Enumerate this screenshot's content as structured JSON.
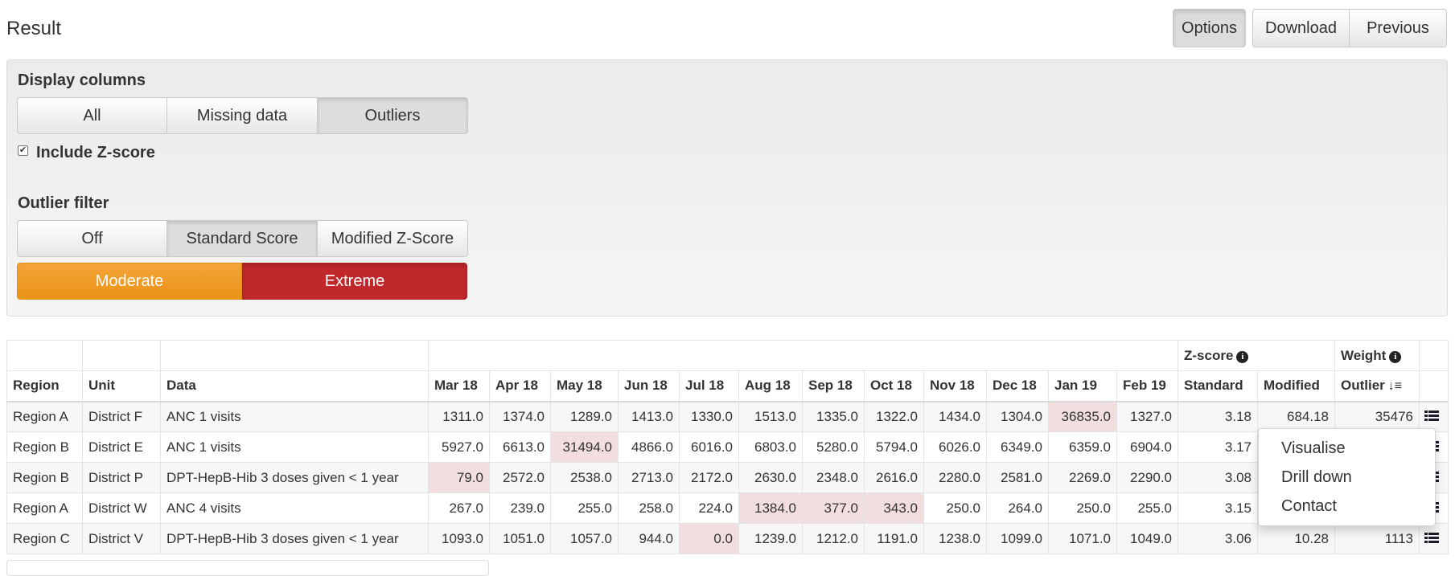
{
  "page": {
    "title": "Result"
  },
  "toolbar": {
    "options_label": "Options",
    "download_label": "Download",
    "previous_label": "Previous"
  },
  "options": {
    "display_columns": {
      "label": "Display columns",
      "buttons": [
        "All",
        "Missing data",
        "Outliers"
      ],
      "active": "Outliers"
    },
    "include_zscore": {
      "label": "Include Z-score",
      "checked": true
    },
    "outlier_filter": {
      "label": "Outlier filter",
      "buttons": [
        "Off",
        "Standard Score",
        "Modified Z-Score"
      ],
      "active": "Standard Score"
    },
    "severity": {
      "moderate": "Moderate",
      "extreme": "Extreme",
      "active": "Extreme",
      "colors": {
        "moderate": "#eb9316",
        "extreme": "#c0282c"
      }
    }
  },
  "table": {
    "group_headers": {
      "zscore": "Z-score",
      "weight": "Weight"
    },
    "headers": {
      "region": "Region",
      "unit": "Unit",
      "data": "Data",
      "standard": "Standard",
      "modified": "Modified",
      "outlier": "Outlier"
    },
    "months": [
      "Mar 18",
      "Apr 18",
      "May 18",
      "Jun 18",
      "Jul 18",
      "Aug 18",
      "Sep 18",
      "Oct 18",
      "Nov 18",
      "Dec 18",
      "Jan 19",
      "Feb 19"
    ],
    "highlight_color": "#f2dede",
    "rows": [
      {
        "region": "Region A",
        "unit": "District F",
        "data": "ANC 1 visits",
        "values": [
          "1311.0",
          "1374.0",
          "1289.0",
          "1413.0",
          "1330.0",
          "1513.0",
          "1335.0",
          "1322.0",
          "1434.0",
          "1304.0",
          "36835.0",
          "1327.0"
        ],
        "highlighted": [
          10
        ],
        "standard": "3.18",
        "modified": "684.18",
        "outlier": "35476"
      },
      {
        "region": "Region B",
        "unit": "District E",
        "data": "ANC 1 visits",
        "values": [
          "5927.0",
          "6613.0",
          "31494.0",
          "4866.0",
          "6016.0",
          "6803.0",
          "5280.0",
          "5794.0",
          "6026.0",
          "6349.0",
          "6359.0",
          "6904.0"
        ],
        "highlighted": [
          2
        ],
        "standard": "3.17",
        "modified": "",
        "outlier": ""
      },
      {
        "region": "Region B",
        "unit": "District P",
        "data": "DPT-HepB-Hib 3 doses given < 1 year",
        "values": [
          "79.0",
          "2572.0",
          "2538.0",
          "2713.0",
          "2172.0",
          "2630.0",
          "2348.0",
          "2616.0",
          "2280.0",
          "2581.0",
          "2269.0",
          "2290.0"
        ],
        "highlighted": [
          0
        ],
        "standard": "3.08",
        "modified": "",
        "outlier": ""
      },
      {
        "region": "Region A",
        "unit": "District W",
        "data": "ANC 4 visits",
        "values": [
          "267.0",
          "239.0",
          "255.0",
          "258.0",
          "224.0",
          "1384.0",
          "377.0",
          "343.0",
          "250.0",
          "264.0",
          "250.0",
          "255.0"
        ],
        "highlighted": [
          5,
          6,
          7
        ],
        "standard": "3.15",
        "modified": "",
        "outlier": ""
      },
      {
        "region": "Region C",
        "unit": "District V",
        "data": "DPT-HepB-Hib 3 doses given < 1 year",
        "values": [
          "1093.0",
          "1051.0",
          "1057.0",
          "944.0",
          "0.0",
          "1239.0",
          "1212.0",
          "1191.0",
          "1238.0",
          "1099.0",
          "1071.0",
          "1049.0"
        ],
        "highlighted": [
          4
        ],
        "standard": "3.06",
        "modified": "10.28",
        "outlier": "1113"
      }
    ]
  },
  "row_menu": {
    "items": [
      "Visualise",
      "Drill down",
      "Contact"
    ]
  },
  "icons": {
    "info": "info-circle-icon",
    "sort": "sort-amount-down-icon",
    "row_menu": "list-icon"
  }
}
